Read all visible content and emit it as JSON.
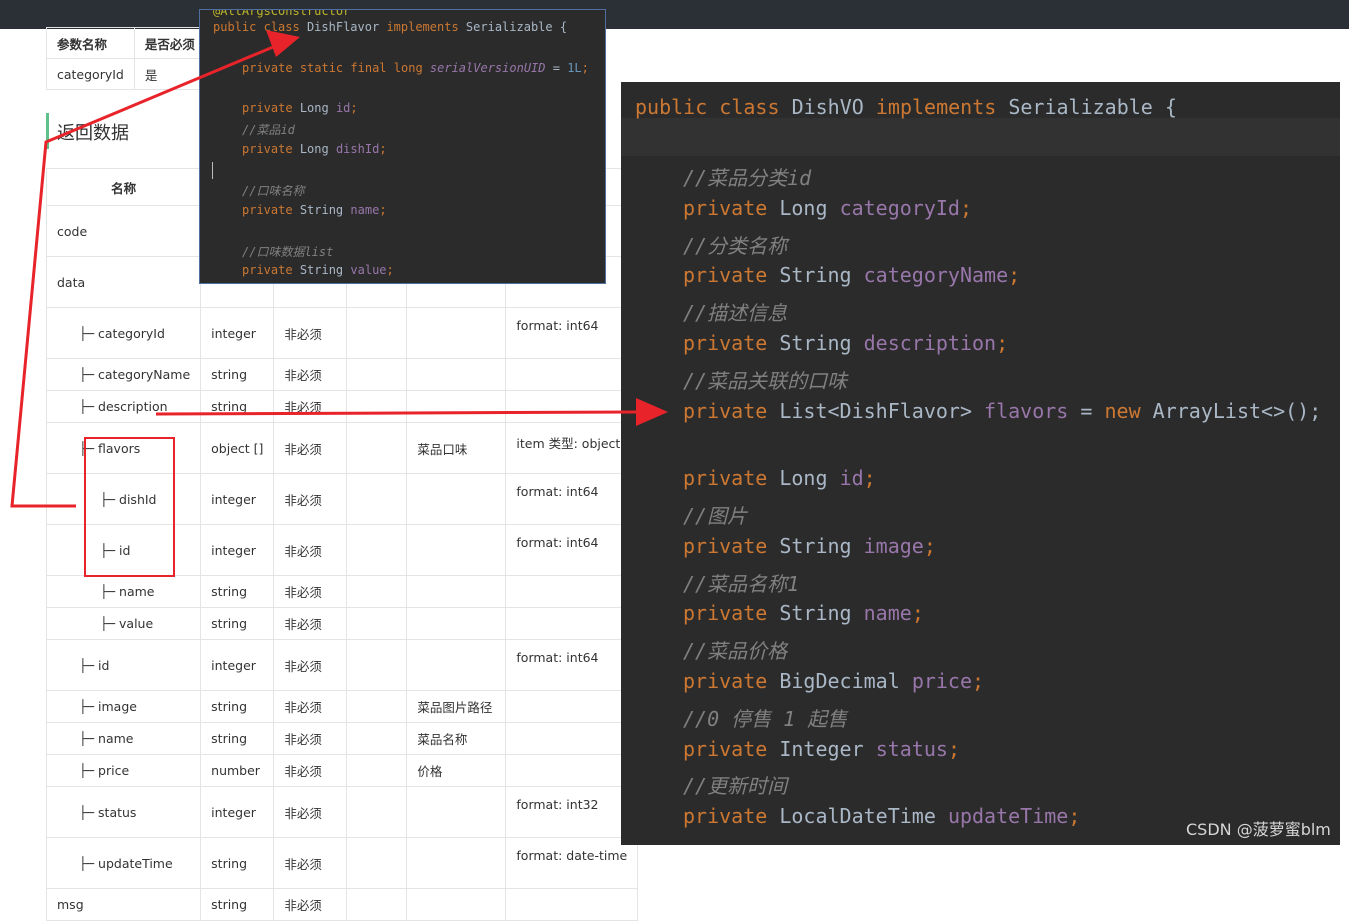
{
  "params_table": {
    "headers": [
      "参数名称",
      "是否必须"
    ],
    "row": [
      "categoryId",
      "是"
    ]
  },
  "section_title": "返回数据",
  "resp_table": {
    "header_name": "名称",
    "rows": [
      {
        "name": "code",
        "type": "",
        "req": "",
        "desc": "",
        "extra": ""
      },
      {
        "name": "data",
        "type": "",
        "req": "",
        "desc": "",
        "extra": "t"
      },
      {
        "name": "├─ categoryId",
        "type": "integer",
        "req": "非必须",
        "desc": "",
        "extra": "format: int64"
      },
      {
        "name": "├─ categoryName",
        "type": "string",
        "req": "非必须",
        "desc": "",
        "extra": ""
      },
      {
        "name": "├─ description",
        "type": "string",
        "req": "非必须",
        "desc": "",
        "extra": ""
      },
      {
        "name": "├─ flavors",
        "type": "object []",
        "req": "非必须",
        "desc": "菜品口味",
        "extra": "item 类型: object"
      },
      {
        "name": "├─ dishId",
        "type": "integer",
        "req": "非必须",
        "desc": "",
        "extra": "format: int64"
      },
      {
        "name": "├─ id",
        "type": "integer",
        "req": "非必须",
        "desc": "",
        "extra": "format: int64"
      },
      {
        "name": "├─ name",
        "type": "string",
        "req": "非必须",
        "desc": "",
        "extra": ""
      },
      {
        "name": "├─ value",
        "type": "string",
        "req": "非必须",
        "desc": "",
        "extra": ""
      },
      {
        "name": "├─ id",
        "type": "integer",
        "req": "非必须",
        "desc": "",
        "extra": "format: int64"
      },
      {
        "name": "├─ image",
        "type": "string",
        "req": "非必须",
        "desc": "菜品图片路径",
        "extra": ""
      },
      {
        "name": "├─ name",
        "type": "string",
        "req": "非必须",
        "desc": "菜品名称",
        "extra": ""
      },
      {
        "name": "├─ price",
        "type": "number",
        "req": "非必须",
        "desc": "价格",
        "extra": ""
      },
      {
        "name": "├─ status",
        "type": "integer",
        "req": "非必须",
        "desc": "",
        "extra": "format: int32"
      },
      {
        "name": "├─ updateTime",
        "type": "string",
        "req": "非必须",
        "desc": "",
        "extra": "format: date-time"
      },
      {
        "name": "msg",
        "type": "string",
        "req": "非必须",
        "desc": "",
        "extra": ""
      }
    ]
  },
  "small_code": {
    "line0": "@AllArgsConstructor",
    "line1": [
      "public",
      "class",
      "DishFlavor",
      "implements",
      "Serializable",
      "{"
    ],
    "line2": [
      "private",
      "static",
      "final",
      "long",
      "serialVersionUID",
      "=",
      "1L",
      ";"
    ],
    "line3": [
      "private",
      "Long",
      "id",
      ";"
    ],
    "line4": "//菜品id",
    "line5": [
      "private",
      "Long",
      "dishId",
      ";"
    ],
    "line6": "//口味名称",
    "line7": [
      "private",
      "String",
      "name",
      ";"
    ],
    "line8": "//口味数据list",
    "line9": [
      "private",
      "String",
      "value",
      ";"
    ]
  },
  "big_code": {
    "header": [
      "public",
      "class",
      "DishVO",
      "implements",
      "Serializable",
      "{"
    ],
    "lines": [
      {
        "comment": "//菜品分类id"
      },
      {
        "kw": "private",
        "type": "Long",
        "field": "categoryId",
        "tail": ";"
      },
      {
        "comment": "//分类名称"
      },
      {
        "kw": "private",
        "type": "String",
        "field": "categoryName",
        "tail": ";"
      },
      {
        "comment": "//描述信息"
      },
      {
        "kw": "private",
        "type": "String",
        "field": "description",
        "tail": ";"
      },
      {
        "comment": "//菜品关联的口味"
      },
      {
        "kw": "private",
        "type": "List<DishFlavor>",
        "field": "flavors",
        "eq": "=",
        "new": "new",
        "init": "ArrayList<>();"
      },
      {
        "kw": "private",
        "type": "Long",
        "field": "id",
        "tail": ";"
      },
      {
        "comment": "//图片"
      },
      {
        "kw": "private",
        "type": "String",
        "field": "image",
        "tail": ";"
      },
      {
        "comment": "//菜品名称1"
      },
      {
        "kw": "private",
        "type": "String",
        "field": "name",
        "tail": ";"
      },
      {
        "comment": "//菜品价格"
      },
      {
        "kw": "private",
        "type": "BigDecimal",
        "field": "price",
        "tail": ";"
      },
      {
        "comment": "//0 停售 1 起售"
      },
      {
        "kw": "private",
        "type": "Integer",
        "field": "status",
        "tail": ";"
      },
      {
        "comment": "//更新时间"
      },
      {
        "kw": "private",
        "type": "LocalDateTime",
        "field": "updateTime",
        "tail": ";"
      }
    ]
  },
  "watermark": "CSDN @菠萝蜜blm",
  "colors": {
    "arrow": "#e8232a",
    "keyword": "#cc7832",
    "field": "#9876aa",
    "comment": "#808080",
    "text": "#a9b7c6",
    "editor_bg": "#2b2b2b"
  }
}
